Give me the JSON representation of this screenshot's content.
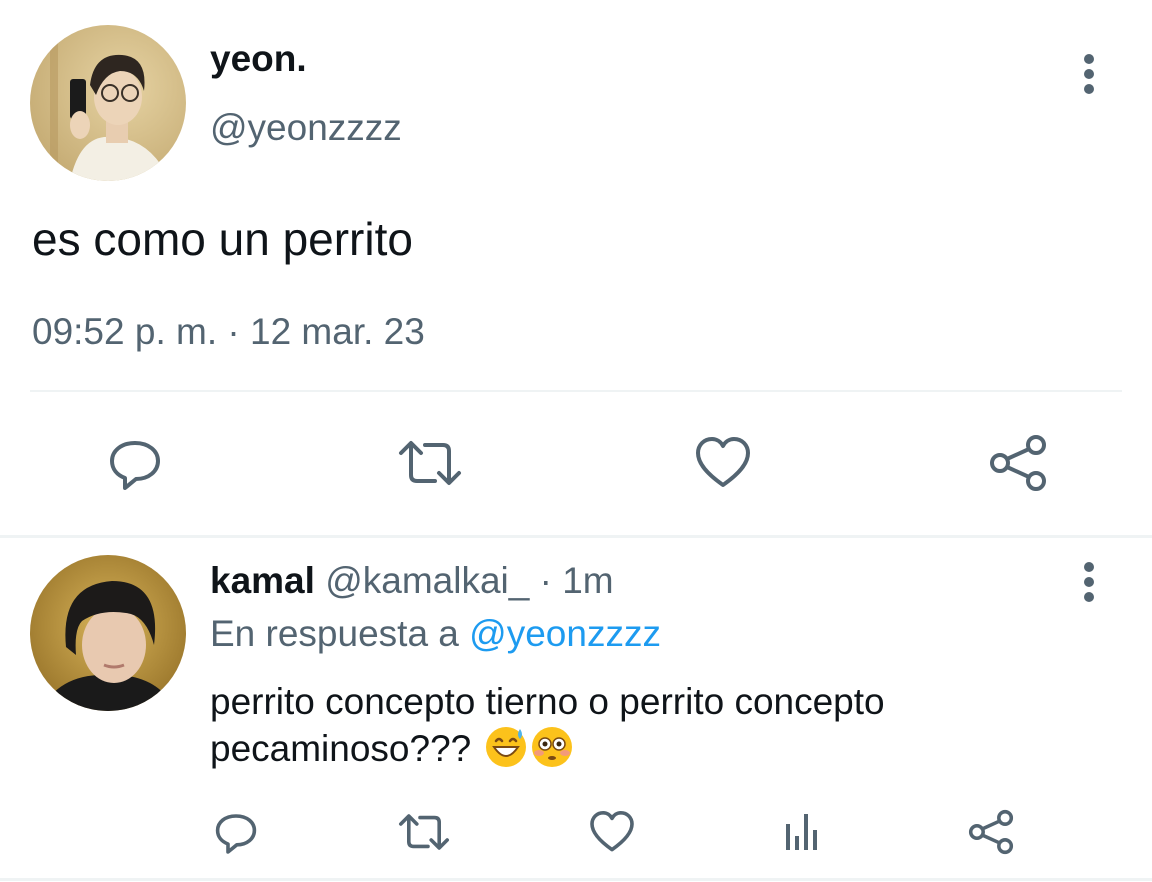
{
  "tweet": {
    "author_name": "yeon.",
    "author_handle": "@yeonzzzz",
    "text": "es como un perrito",
    "time": "09:52 p. m.",
    "separator": "·",
    "date": "12 mar. 23"
  },
  "reply": {
    "author_name": "kamal",
    "author_handle": "@kamalkai_",
    "separator": "·",
    "time": "1m",
    "replying_to_label": "En respuesta a",
    "replying_to_handle": "@yeonzzzz",
    "text": "perrito concepto tierno o perrito concepto pecaminoso???",
    "emojis": [
      "grinning-sweat-emoji",
      "flushed-face-emoji"
    ]
  },
  "icons": {
    "reply": "speech-bubble-icon",
    "retweet": "retweet-arrows-icon",
    "like": "heart-icon",
    "share": "share-nodes-icon",
    "analytics": "bar-chart-icon",
    "more": "vertical-dots-icon"
  },
  "colors": {
    "text_primary": "#0f1419",
    "text_secondary": "#536471",
    "link": "#1d9bf0",
    "divider": "#eff3f4"
  }
}
